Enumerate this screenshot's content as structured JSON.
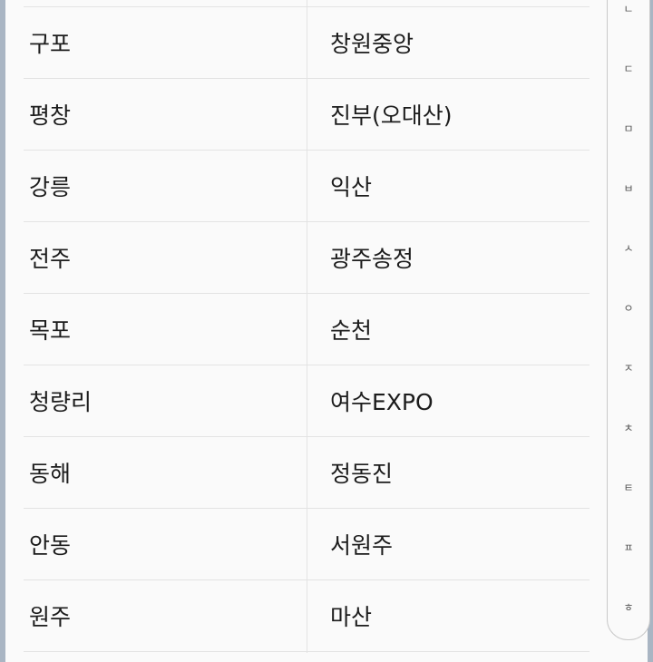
{
  "stations": [
    {
      "left": "구포",
      "right": "창원중앙"
    },
    {
      "left": "평창",
      "right": "진부(오대산)"
    },
    {
      "left": "강릉",
      "right": "익산"
    },
    {
      "left": "전주",
      "right": "광주송정"
    },
    {
      "left": "목포",
      "right": "순천"
    },
    {
      "left": "청량리",
      "right": "여수EXPO"
    },
    {
      "left": "동해",
      "right": "정동진"
    },
    {
      "left": "안동",
      "right": "서원주"
    },
    {
      "left": "원주",
      "right": "마산"
    }
  ],
  "index_bar": {
    "letters": [
      "ㄴ",
      "ㄷ",
      "ㅁ",
      "ㅂ",
      "ㅅ",
      "ㅇ",
      "ㅈ",
      "ㅊ",
      "ㅌ",
      "ㅍ",
      "ㅎ"
    ]
  }
}
